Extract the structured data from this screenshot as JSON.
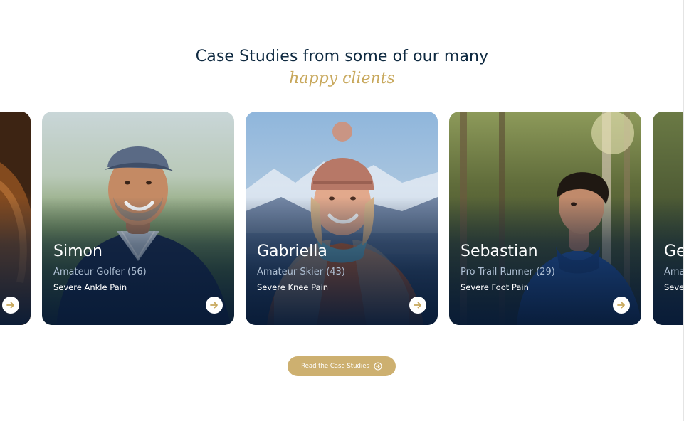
{
  "heading": {
    "title": "Case Studies from some of our many",
    "subtitle": "happy clients"
  },
  "cards": [
    {
      "name": "",
      "role": "",
      "condition": ""
    },
    {
      "name": "Simon",
      "role": "Amateur Golfer (56)",
      "condition": "Severe Ankle Pain"
    },
    {
      "name": "Gabriella",
      "role": "Amateur Skier (43)",
      "condition": "Severe Knee Pain"
    },
    {
      "name": "Sebastian",
      "role": "Pro Trail Runner (29)",
      "condition": "Severe Foot Pain"
    },
    {
      "name": "Ge",
      "role": "Ama",
      "condition": "Seve"
    }
  ],
  "cta": {
    "label": "Read the Case Studies",
    "icon": "arrow-circle-icon"
  },
  "icons": {
    "card_arrow": "arrow-right-icon"
  },
  "colors": {
    "heading": "#0e2940",
    "accent_gold": "#c8a85c",
    "button": "#cdb070",
    "card_overlay": "#081b37"
  }
}
